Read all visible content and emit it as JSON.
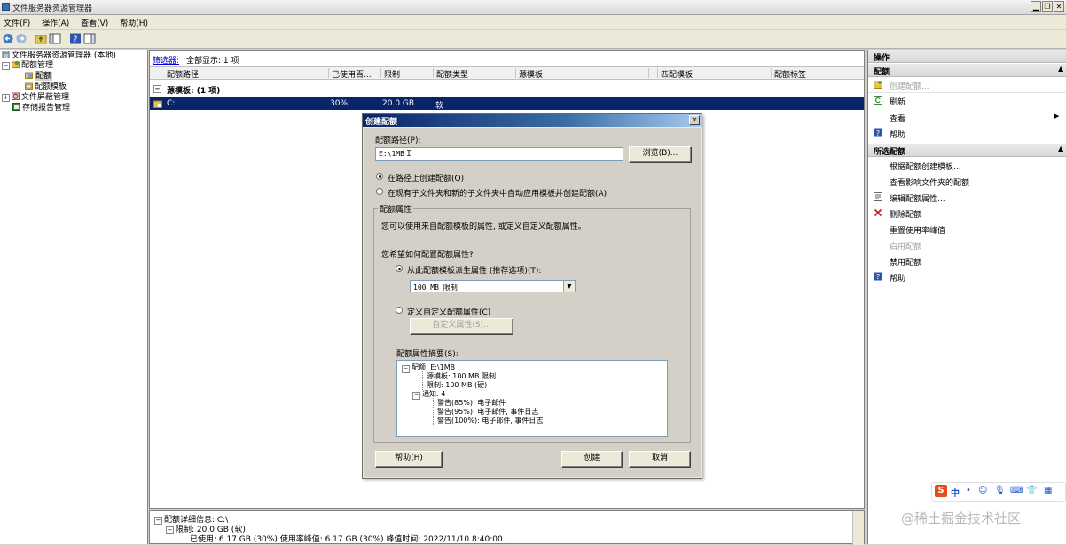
{
  "window": {
    "title": "文件服务器资源管理器",
    "buttons": [
      "▁",
      "❐",
      "✕"
    ]
  },
  "menu": [
    "文件(F)",
    "操作(A)",
    "查看(V)",
    "帮助(H)"
  ],
  "tree": {
    "root": "文件服务器资源管理器 (本地)",
    "quota_mgmt": "配额管理",
    "quotas": "配额",
    "quota_templates": "配额模板",
    "file_screening": "文件屏蔽管理",
    "storage_reports": "存储报告管理"
  },
  "filter": {
    "link": "筛选器:",
    "text": "全部显示: 1 项"
  },
  "columns": [
    "配额路径",
    "已使用百...",
    "限制",
    "配额类型",
    "源模板",
    "匹配模板",
    "配额标签"
  ],
  "group": "源模板:  (1 项)",
  "row": {
    "path": "C:",
    "used": "30%",
    "limit": "20.0 GB",
    "type": "软"
  },
  "details": {
    "line1": "配额详细信息: C:\\",
    "line2": "限制: 20.0 GB (软)",
    "line3": "已使用: 6.17 GB (30%) 使用率峰值: 6.17 GB (30%) 峰值时间: 2022/11/10 8:40:00."
  },
  "actions": {
    "header": "操作",
    "section1": "配额",
    "items1": [
      {
        "label": "创建配额...",
        "disabled": true,
        "icon": "create-quota-icon"
      },
      {
        "label": "刷新",
        "disabled": false,
        "icon": "refresh-icon"
      },
      {
        "label": "查看",
        "disabled": false,
        "icon": "none",
        "submenu": "▶"
      },
      {
        "label": "帮助",
        "disabled": false,
        "icon": "help-icon"
      }
    ],
    "section2": "所选配额",
    "items2": [
      {
        "label": "根据配额创建模板...",
        "disabled": false,
        "icon": "none"
      },
      {
        "label": "查看影响文件夹的配额",
        "disabled": false,
        "icon": "none"
      },
      {
        "label": "编辑配额属性...",
        "disabled": false,
        "icon": "properties-icon"
      },
      {
        "label": "删除配额",
        "disabled": false,
        "icon": "delete-icon"
      },
      {
        "label": "重置使用率峰值",
        "disabled": false,
        "icon": "none"
      },
      {
        "label": "启用配额",
        "disabled": true,
        "icon": "none"
      },
      {
        "label": "禁用配额",
        "disabled": false,
        "icon": "none"
      },
      {
        "label": "帮助",
        "disabled": false,
        "icon": "help-icon"
      }
    ]
  },
  "dialog": {
    "title": "创建配额",
    "close": "✕",
    "path_label": "配额路径(P):",
    "path_value": "E:\\1MB",
    "browse": "浏览(B)...",
    "radio1": "在路径上创建配额(Q)",
    "radio2": "在现有子文件夹和新的子文件夹中自动应用模板并创建配额(A)",
    "props_group": "配额属性",
    "props_desc": "您可以使用来自配额模板的属性, 或定义自定义配额属性。",
    "how_question": "您希望如何配置配额属性?",
    "radio_template": "从此配额模板派生属性 (推荐选项)(T):",
    "template_value": "100 MB 限制",
    "radio_custom": "定义自定义配额属性(C)",
    "custom_btn": "自定义属性(S)...",
    "summary_label": "配额属性摘要(S):",
    "summary": [
      "配额: E:\\1MB",
      "源模板: 100 MB 限制",
      "限制: 100 MB (硬)",
      "通知: 4",
      "警告(85%): 电子邮件",
      "警告(95%): 电子邮件, 事件日志",
      "警告(100%): 电子邮件, 事件日志"
    ],
    "help": "帮助(H)",
    "create": "创建",
    "cancel": "取消"
  },
  "ime": {
    "lang": "中",
    "items": [
      "•",
      "☺",
      "🎙",
      "⌨",
      "👕",
      "▦"
    ]
  },
  "watermark": "@稀土掘金技术社区",
  "colors": {
    "selection": "#0a246a",
    "titlebar": "#0a246a",
    "link": "#0000cc"
  }
}
